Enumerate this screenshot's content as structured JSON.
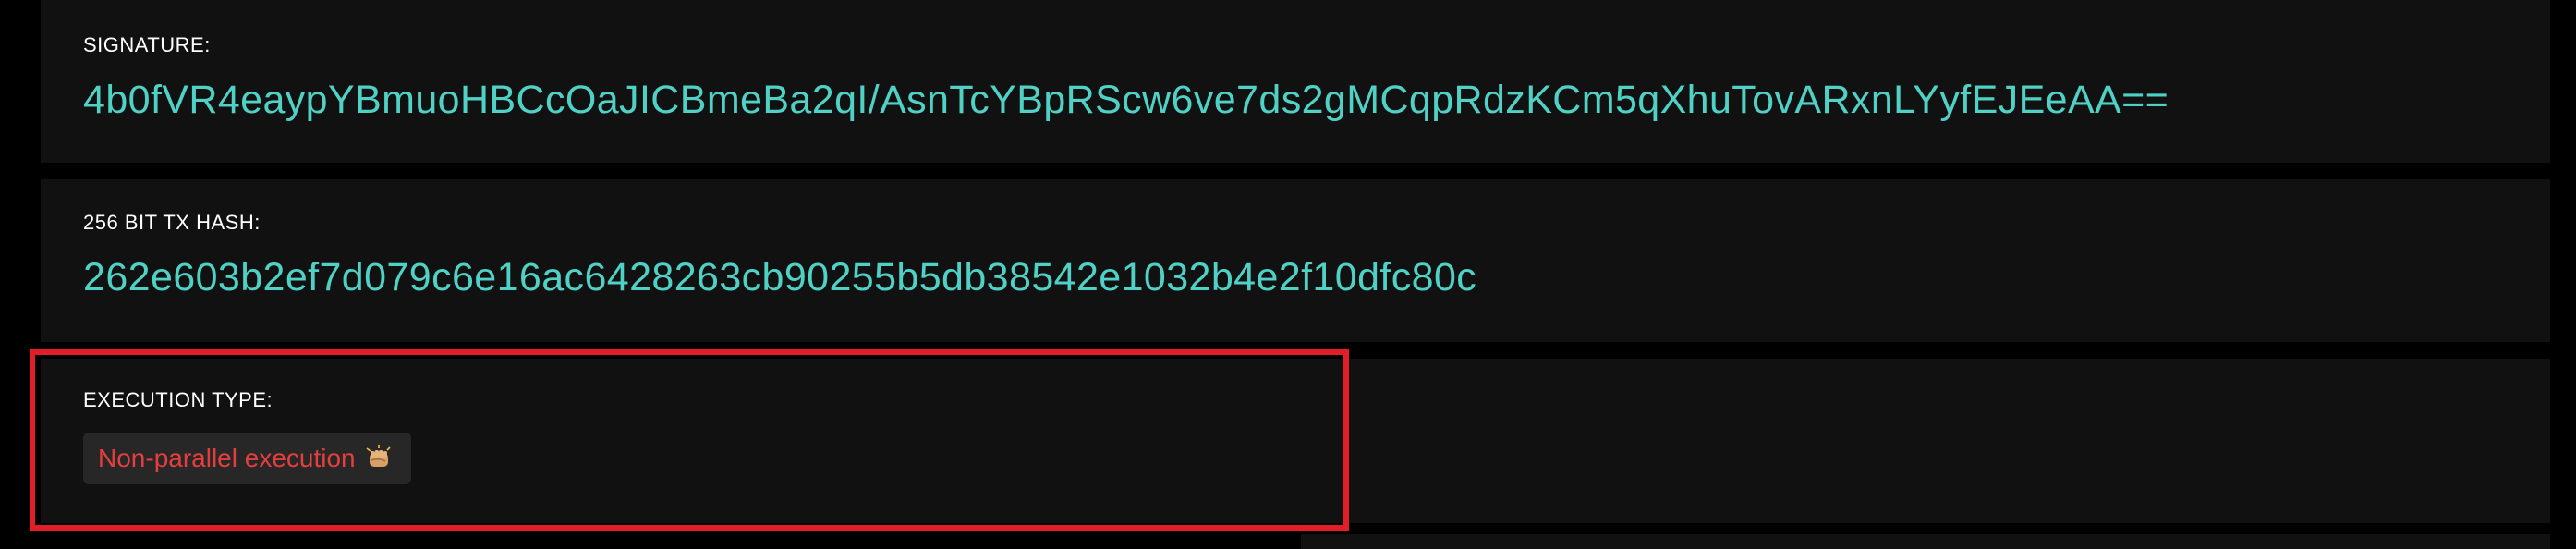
{
  "signature": {
    "label": "SIGNATURE:",
    "value": "4b0fVR4eaypYBmuoHBCcOaJICBmeBa2qI/AsnTcYBpRScw6ve7ds2gMCqpRdzKCm5qXhuTovARxnLYyfEJEeAA=="
  },
  "tx_hash": {
    "label": "256 BIT TX HASH:",
    "value": "262e603b2ef7d079c6e16ac6428263cb90255b5db38542e1032b4e2f10dfc80c"
  },
  "execution": {
    "label": "EXECUTION TYPE:",
    "badge_text": "Non-parallel execution",
    "badge_icon": "fist-icon"
  },
  "colors": {
    "background": "#000000",
    "card": "#111111",
    "value_text": "#4fd1c5",
    "badge_bg": "#272727",
    "badge_text": "#e53e3e",
    "highlight": "#e41e26"
  }
}
